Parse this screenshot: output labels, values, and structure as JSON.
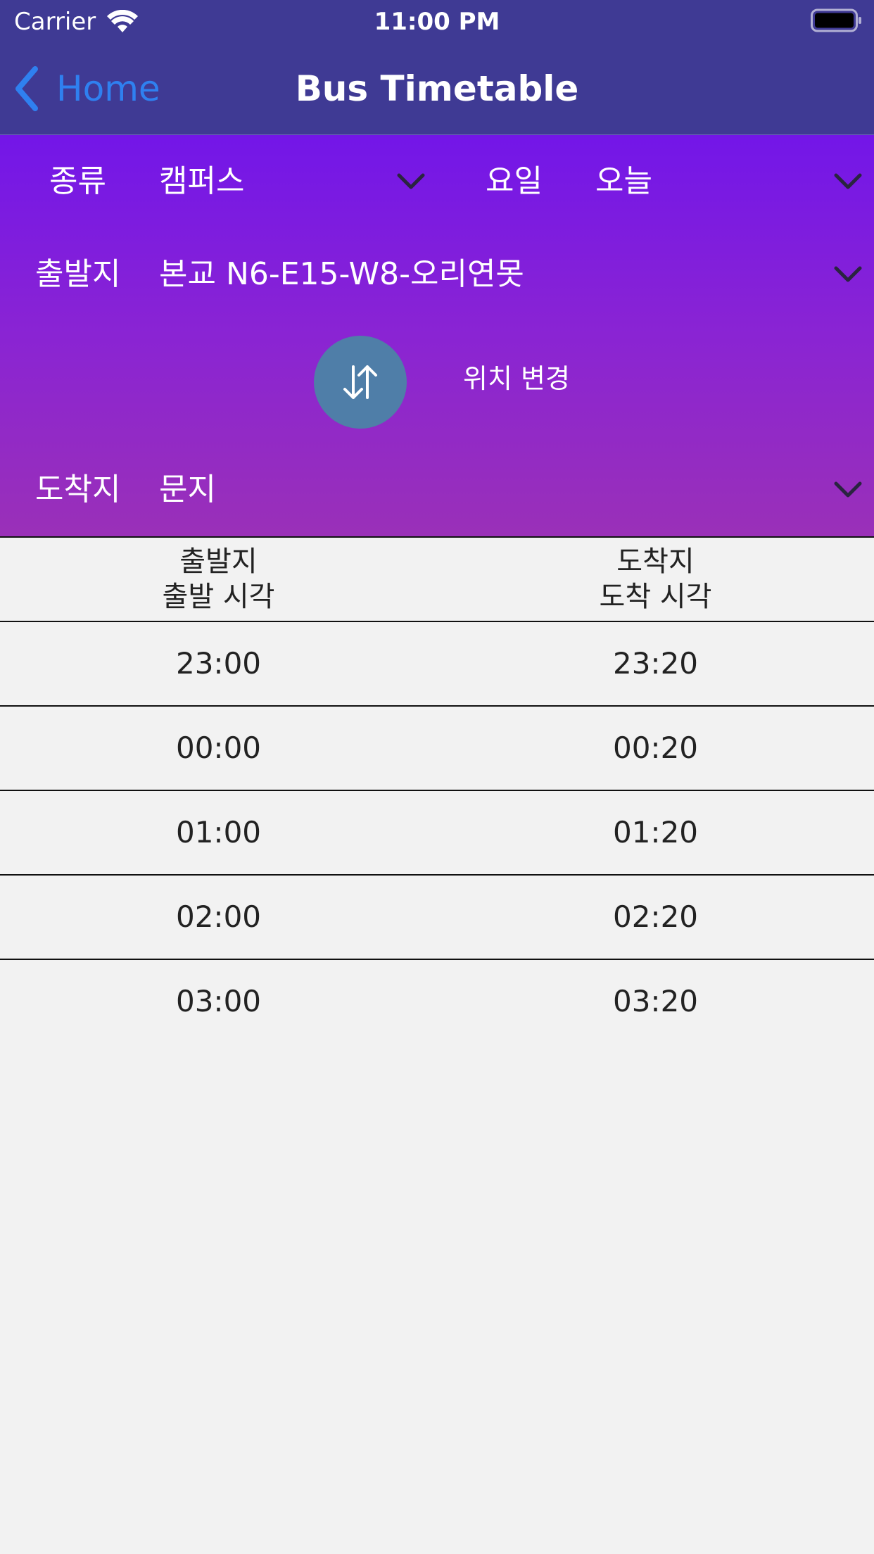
{
  "status_bar": {
    "carrier": "Carrier",
    "time": "11:00 PM"
  },
  "nav": {
    "back_label": "Home",
    "title": "Bus Timetable"
  },
  "filters": {
    "type_label": "종류",
    "type_value": "캠퍼스",
    "day_label": "요일",
    "day_value": "오늘",
    "origin_label": "출발지",
    "origin_value": "본교 N6-E15-W8-오리연못",
    "swap_label": "위치 변경",
    "destination_label": "도착지",
    "destination_value": "문지"
  },
  "table": {
    "headers": {
      "left_line1": "출발지",
      "left_line2": "출발 시각",
      "right_line1": "도착지",
      "right_line2": "도착 시각"
    },
    "rows": [
      {
        "depart": "23:00",
        "arrive": "23:20"
      },
      {
        "depart": "00:00",
        "arrive": "00:20"
      },
      {
        "depart": "01:00",
        "arrive": "01:20"
      },
      {
        "depart": "02:00",
        "arrive": "02:20"
      },
      {
        "depart": "03:00",
        "arrive": "03:20"
      }
    ]
  },
  "icons": {
    "wifi": "wifi-icon",
    "battery": "battery-icon",
    "back": "chevron-left-icon",
    "dropdown": "chevron-down-icon",
    "swap": "swap-arrows-icon"
  },
  "colors": {
    "nav_background": "#3f3a94",
    "gradient_top": "#7316e8",
    "gradient_bottom": "#9a30b8",
    "back_tint": "#2f80f0",
    "swap_button": "#4f7ea8",
    "table_background": "#f2f2f2"
  }
}
